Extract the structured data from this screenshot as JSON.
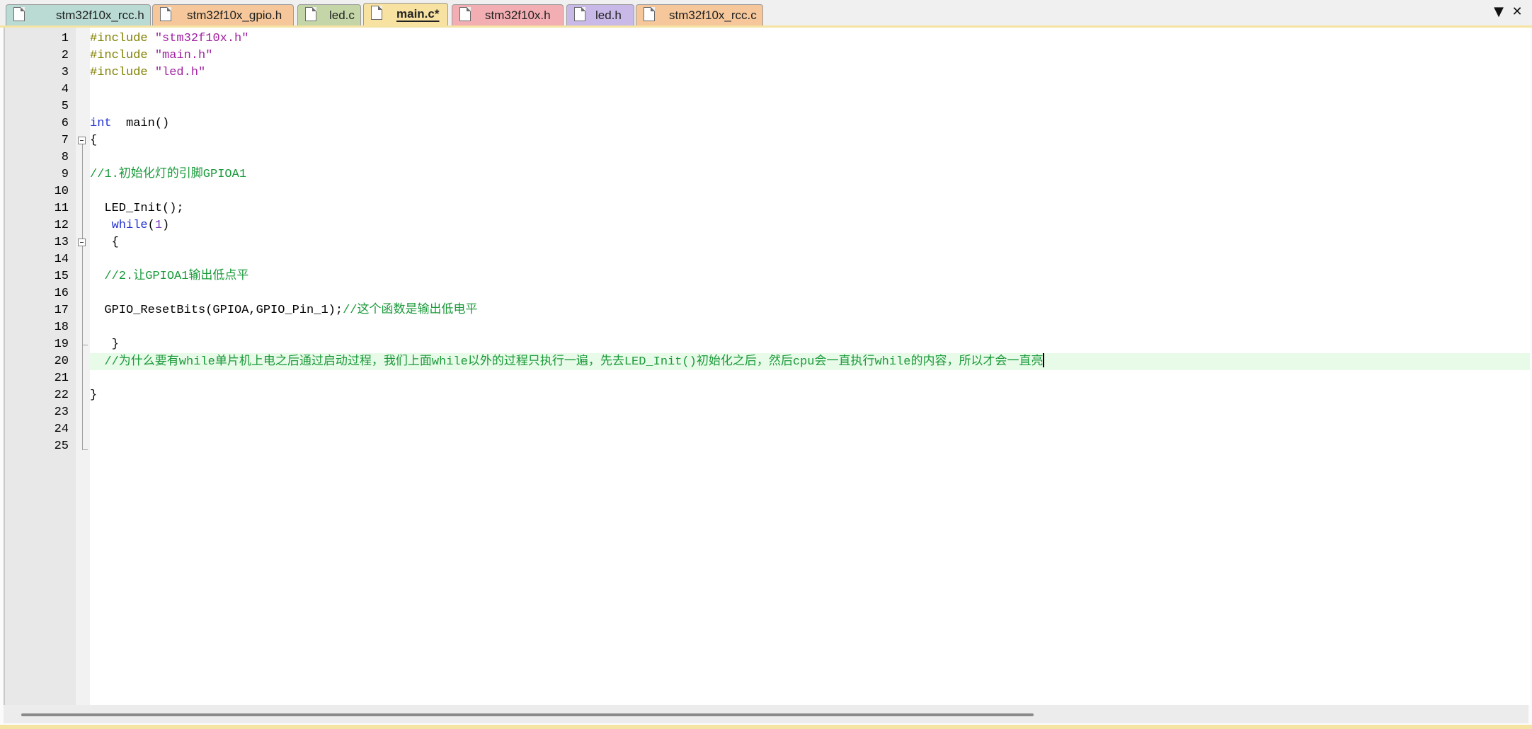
{
  "tabs": [
    {
      "label": "stm32f10x_rcc.h",
      "color": "#b9dbd4",
      "active": false
    },
    {
      "label": "stm32f10x_gpio.h",
      "color": "#f5c79a",
      "active": false
    },
    {
      "label": "led.c",
      "color": "#c4d6a8",
      "active": false
    },
    {
      "label": "main.c*",
      "color": "#f7e2a2",
      "active": true
    },
    {
      "label": "stm32f10x.h",
      "color": "#f3aeb3",
      "active": false
    },
    {
      "label": "led.h",
      "color": "#c9b9e8",
      "active": false
    },
    {
      "label": "stm32f10x_rcc.c",
      "color": "#f5c79a",
      "active": false
    }
  ],
  "tab_controls": {
    "dropdown_icon": "▼",
    "close_icon": "✕"
  },
  "editor": {
    "current_line": 20,
    "lines": [
      {
        "n": "1",
        "tokens": [
          [
            "pp",
            "#include "
          ],
          [
            "str",
            "\"stm32f10x.h\""
          ]
        ]
      },
      {
        "n": "2",
        "tokens": [
          [
            "pp",
            "#include "
          ],
          [
            "str",
            "\"main.h\""
          ]
        ]
      },
      {
        "n": "3",
        "tokens": [
          [
            "pp",
            "#include "
          ],
          [
            "str",
            "\"led.h\""
          ]
        ]
      },
      {
        "n": "4",
        "tokens": []
      },
      {
        "n": "5",
        "tokens": []
      },
      {
        "n": "6",
        "tokens": [
          [
            "kw",
            "int"
          ],
          [
            "txt",
            "  main()"
          ]
        ]
      },
      {
        "n": "7",
        "tokens": [
          [
            "txt",
            "{"
          ]
        ]
      },
      {
        "n": "8",
        "tokens": []
      },
      {
        "n": "9",
        "tokens": [
          [
            "cmt",
            "//1.初始化灯的引脚GPIOA1"
          ]
        ]
      },
      {
        "n": "10",
        "tokens": []
      },
      {
        "n": "11",
        "tokens": [
          [
            "txt",
            "  LED_Init();"
          ]
        ]
      },
      {
        "n": "12",
        "tokens": [
          [
            "txt",
            "   "
          ],
          [
            "kw",
            "while"
          ],
          [
            "txt",
            "("
          ],
          [
            "num",
            "1"
          ],
          [
            "txt",
            ")"
          ]
        ]
      },
      {
        "n": "13",
        "tokens": [
          [
            "txt",
            "   {"
          ]
        ]
      },
      {
        "n": "14",
        "tokens": []
      },
      {
        "n": "15",
        "tokens": [
          [
            "cmt",
            "  //2.让GPIOA1输出低点平"
          ]
        ]
      },
      {
        "n": "16",
        "tokens": []
      },
      {
        "n": "17",
        "tokens": [
          [
            "txt",
            "  GPIO_ResetBits(GPIOA,GPIO_Pin_1);"
          ],
          [
            "cmt",
            "//这个函数是输出低电平"
          ]
        ]
      },
      {
        "n": "18",
        "tokens": []
      },
      {
        "n": "19",
        "tokens": [
          [
            "txt",
            "   }"
          ]
        ]
      },
      {
        "n": "20",
        "tokens": [
          [
            "cmt",
            "  //为什么要有while单片机上电之后通过启动过程，我们上面while以外的过程只执行一遍，先去LED_Init()初始化之后，然后cpu会一直执行while的内容，所以才会一直亮"
          ]
        ]
      },
      {
        "n": "21",
        "tokens": []
      },
      {
        "n": "22",
        "tokens": [
          [
            "txt",
            "}"
          ]
        ]
      },
      {
        "n": "23",
        "tokens": []
      },
      {
        "n": "24",
        "tokens": []
      },
      {
        "n": "25",
        "tokens": []
      }
    ]
  }
}
